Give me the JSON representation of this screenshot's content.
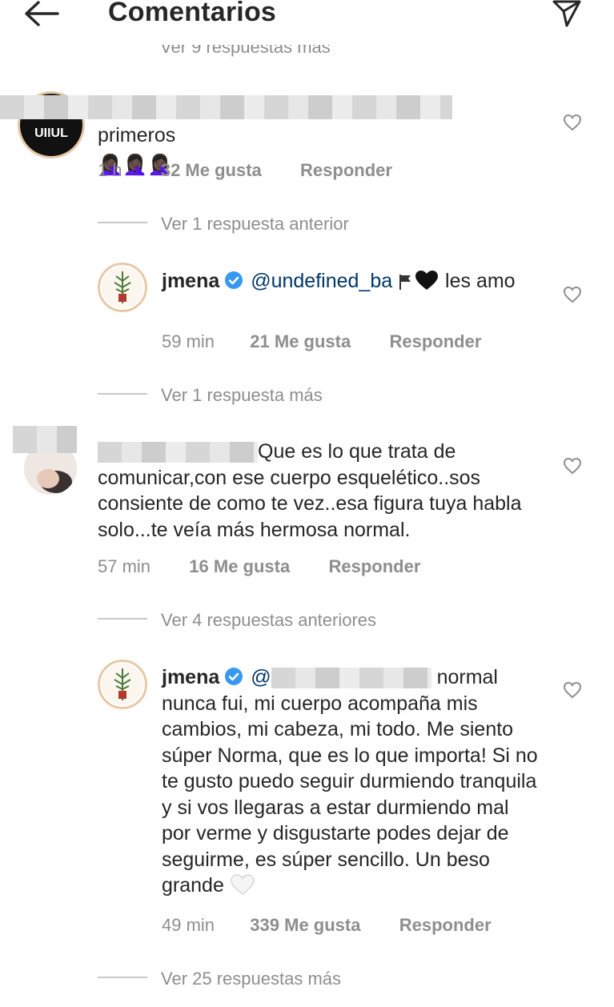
{
  "header": {
    "title": "Comentarios"
  },
  "top_cut_text": "Ver 9 respuestas más",
  "comments": [
    {
      "text": "primeros",
      "emoji": "🤦🏿‍♀️🤦🏿‍♀️🤦🏿‍♀️",
      "time": "1 h",
      "likes": "32 Me gusta",
      "reply": "Responder"
    },
    {
      "replies_link": "Ver 1 respuesta anterior",
      "username": "jmena",
      "mention": "@undefined_ba",
      "text": "les amo",
      "time": "59 min",
      "likes": "21 Me gusta",
      "reply": "Responder"
    },
    {
      "replies_link": "Ver 1 respuesta más",
      "text_line1": "Que es lo que trata de",
      "text_rest": "comunicar,con ese cuerpo esquelético..sos consiente de como te vez..esa figura tuya habla solo...te veía más hermosa normal.",
      "time": "57 min",
      "likes": "16 Me gusta",
      "reply": "Responder"
    },
    {
      "replies_link": "Ver 4 respuestas anteriores",
      "username": "jmena",
      "mention": "@",
      "text_line1": "normal",
      "text_rest": "nunca fui, mi cuerpo acompaña mis cambios, mi cabeza, mi todo. Me siento súper Norma, que es lo que importa! Si no te gusto puedo seguir durmiendo tranquila y si vos llegaras a estar durmiendo mal por verme y disgustarte podes dejar de seguirme, es súper sencillo. Un beso grande",
      "time": "49 min",
      "likes": "339 Me gusta",
      "reply": "Responder"
    }
  ],
  "bottom_replies_link": "Ver 25 respuestas más",
  "colors": {
    "text": "#262626",
    "secondary": "#8e8e8e",
    "mention": "#00376b",
    "verified": "#3897f0"
  }
}
